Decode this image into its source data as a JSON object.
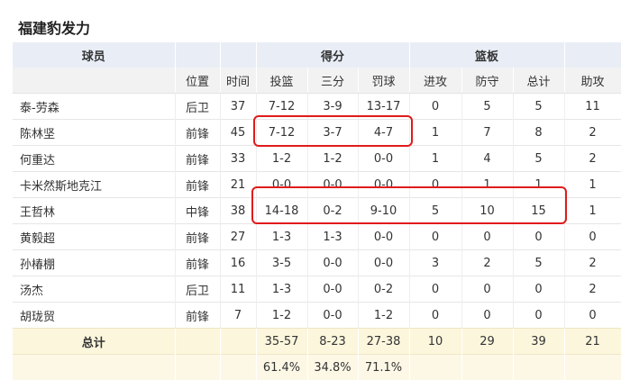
{
  "title": "福建豹发力",
  "group_headers": {
    "player": "球员",
    "scoring": "得分",
    "rebounds": "篮板"
  },
  "sub_headers": {
    "position": "位置",
    "minutes": "时间",
    "fg": "投篮",
    "three": "三分",
    "ft": "罚球",
    "oreb": "进攻",
    "dreb": "防守",
    "treb": "总计",
    "ast": "助攻"
  },
  "rows": [
    {
      "name": "泰-劳森",
      "pos": "后卫",
      "min": "37",
      "fg": "7-12",
      "three": "3-9",
      "ft": "13-17",
      "oreb": "0",
      "dreb": "5",
      "treb": "5",
      "ast": "11"
    },
    {
      "name": "陈林坚",
      "pos": "前锋",
      "min": "45",
      "fg": "7-12",
      "three": "3-7",
      "ft": "4-7",
      "oreb": "1",
      "dreb": "7",
      "treb": "8",
      "ast": "2"
    },
    {
      "name": "何重达",
      "pos": "前锋",
      "min": "33",
      "fg": "1-2",
      "three": "1-2",
      "ft": "0-0",
      "oreb": "1",
      "dreb": "4",
      "treb": "5",
      "ast": "2"
    },
    {
      "name": "卡米然斯地克江",
      "pos": "前锋",
      "min": "21",
      "fg": "0-0",
      "three": "0-0",
      "ft": "0-0",
      "oreb": "0",
      "dreb": "1",
      "treb": "1",
      "ast": "1"
    },
    {
      "name": "王哲林",
      "pos": "中锋",
      "min": "38",
      "fg": "14-18",
      "three": "0-2",
      "ft": "9-10",
      "oreb": "5",
      "dreb": "10",
      "treb": "15",
      "ast": "1"
    },
    {
      "name": "黄毅超",
      "pos": "前锋",
      "min": "27",
      "fg": "1-3",
      "three": "1-3",
      "ft": "0-0",
      "oreb": "0",
      "dreb": "0",
      "treb": "0",
      "ast": "0"
    },
    {
      "name": "孙椿棚",
      "pos": "前锋",
      "min": "16",
      "fg": "3-5",
      "three": "0-0",
      "ft": "0-0",
      "oreb": "3",
      "dreb": "2",
      "treb": "5",
      "ast": "2"
    },
    {
      "name": "汤杰",
      "pos": "后卫",
      "min": "11",
      "fg": "1-3",
      "three": "0-0",
      "ft": "0-2",
      "oreb": "0",
      "dreb": "0",
      "treb": "0",
      "ast": "2"
    },
    {
      "name": "胡珑贸",
      "pos": "前锋",
      "min": "7",
      "fg": "1-2",
      "three": "0-0",
      "ft": "1-2",
      "oreb": "0",
      "dreb": "0",
      "treb": "0",
      "ast": "0"
    }
  ],
  "totals": {
    "label": "总计",
    "fg": "35-57",
    "three": "8-23",
    "ft": "27-38",
    "oreb": "10",
    "dreb": "29",
    "treb": "39",
    "ast": "21"
  },
  "percentages": {
    "fg": "61.4%",
    "three": "34.8%",
    "ft": "71.1%"
  },
  "highlight_color": "#e01b1b"
}
